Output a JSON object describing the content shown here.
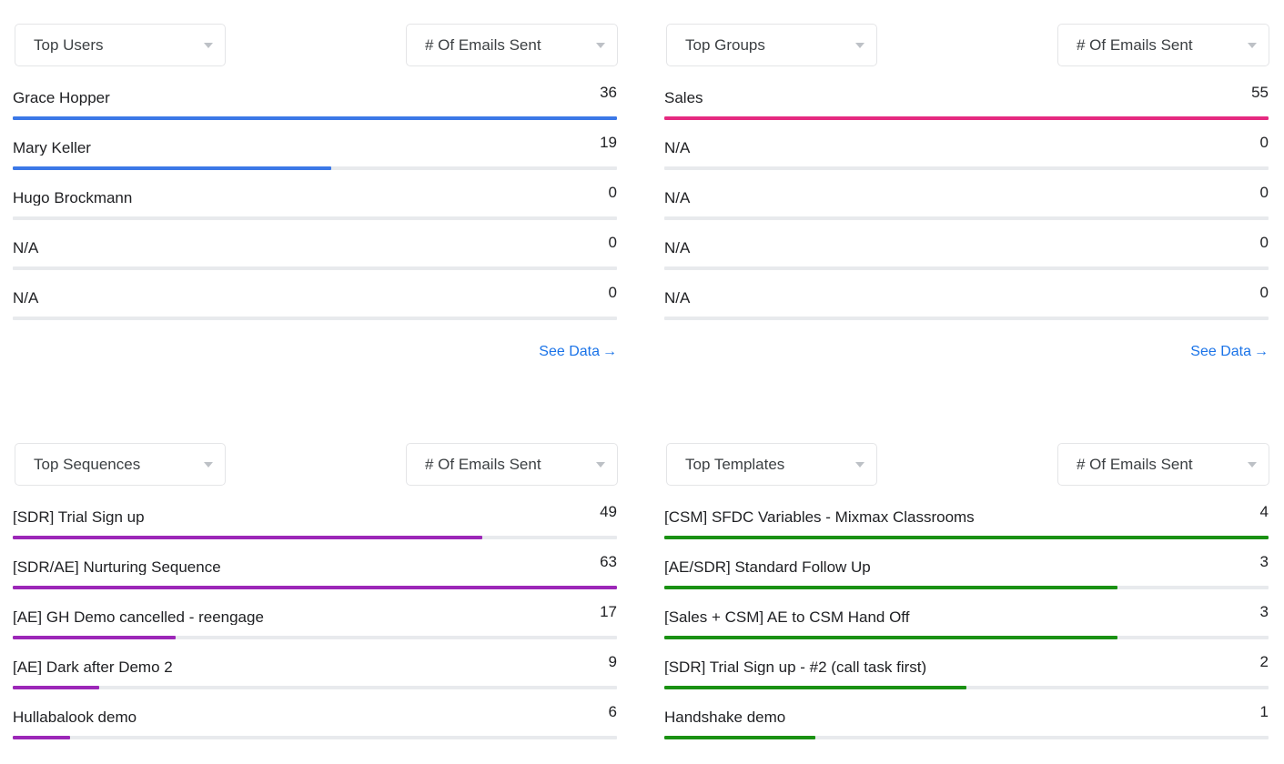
{
  "ui": {
    "caret_icon": "chevron-down-icon",
    "see_data_label": "See Data",
    "see_data_arrow": "→",
    "track_color": "#e8eaed"
  },
  "chart_data": [
    {
      "type": "bar",
      "orientation": "horizontal",
      "panel": "top-users",
      "title": "Top Users",
      "metric": "# Of Emails Sent",
      "color": "#3b78e7",
      "max": 36,
      "has_see_data": true,
      "categories": [
        "Grace Hopper",
        "Mary Keller",
        "Hugo Brockmann",
        "N/A",
        "N/A"
      ],
      "values": [
        36,
        19,
        0,
        0,
        0
      ]
    },
    {
      "type": "bar",
      "orientation": "horizontal",
      "panel": "top-groups",
      "title": "Top Groups",
      "metric": "# Of Emails Sent",
      "color": "#e52a80",
      "max": 55,
      "has_see_data": true,
      "categories": [
        "Sales",
        "N/A",
        "N/A",
        "N/A",
        "N/A"
      ],
      "values": [
        55,
        0,
        0,
        0,
        0
      ]
    },
    {
      "type": "bar",
      "orientation": "horizontal",
      "panel": "top-sequences",
      "title": "Top Sequences",
      "metric": "# Of Emails Sent",
      "color": "#9c27b8",
      "max": 63,
      "has_see_data": false,
      "categories": [
        "[SDR] Trial Sign up",
        "[SDR/AE] Nurturing Sequence",
        "[AE] GH Demo cancelled - reengage",
        "[AE] Dark after Demo 2",
        "Hullabalook demo"
      ],
      "values": [
        49,
        63,
        17,
        9,
        6
      ]
    },
    {
      "type": "bar",
      "orientation": "horizontal",
      "panel": "top-templates",
      "title": "Top Templates",
      "metric": "# Of Emails Sent",
      "color": "#1a9113",
      "max": 4,
      "has_see_data": false,
      "categories": [
        "[CSM] SFDC Variables - Mixmax Classrooms",
        "[AE/SDR] Standard Follow Up",
        "[Sales + CSM] AE to CSM Hand Off",
        "[SDR] Trial Sign up - #2 (call task first)",
        "Handshake demo"
      ],
      "values": [
        4,
        3,
        3,
        2,
        1
      ]
    }
  ]
}
